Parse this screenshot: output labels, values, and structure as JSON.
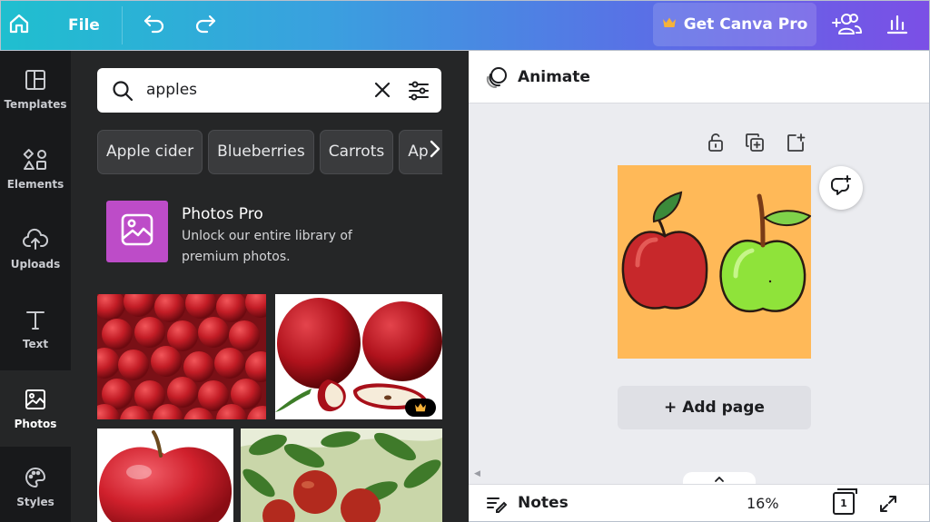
{
  "topbar": {
    "file_label": "File",
    "pro_label": "Get Canva Pro",
    "colors": {
      "gradient_start": "#1fbfcf",
      "gradient_end": "#7b4fe6",
      "crown": "#f5b23a"
    }
  },
  "leftnav": {
    "items": [
      {
        "label": "Templates",
        "icon": "templates-icon"
      },
      {
        "label": "Elements",
        "icon": "elements-icon"
      },
      {
        "label": "Uploads",
        "icon": "cloud-upload-icon"
      },
      {
        "label": "Text",
        "icon": "text-icon"
      },
      {
        "label": "Photos",
        "icon": "photo-icon",
        "active": true
      },
      {
        "label": "Styles",
        "icon": "palette-icon"
      }
    ]
  },
  "panel": {
    "search_value": "apples",
    "suggestions": [
      "Apple cider",
      "Blueberries",
      "Carrots",
      "Ap"
    ],
    "promo": {
      "title": "Photos Pro",
      "description": "Unlock our entire library of premium photos."
    },
    "results": [
      {
        "name": "pile-of-red-apples"
      },
      {
        "name": "red-apples-with-slices",
        "pro": true
      },
      {
        "name": "single-red-apple"
      },
      {
        "name": "apples-on-tree"
      }
    ]
  },
  "editor": {
    "animate_label": "Animate",
    "add_page_label": "+ Add page",
    "notes_label": "Notes",
    "zoom_level": "16%",
    "page_count": "1",
    "design": {
      "background": "#ffb958",
      "content": [
        "red apple",
        "green apple"
      ]
    }
  }
}
